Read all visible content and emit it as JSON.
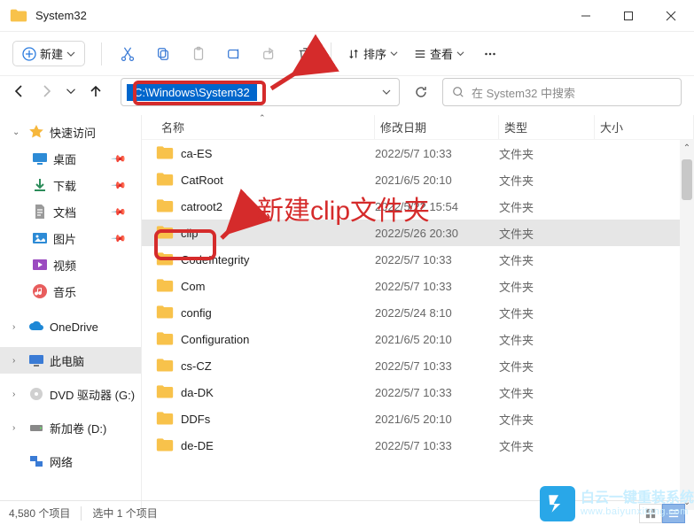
{
  "window": {
    "title": "System32"
  },
  "toolbar": {
    "new_label": "新建",
    "sort_label": "排序",
    "view_label": "查看"
  },
  "address": {
    "path": "C:\\Windows\\System32"
  },
  "search": {
    "placeholder": "在 System32 中搜索"
  },
  "sidebar": {
    "quick": "快速访问",
    "desktop": "桌面",
    "downloads": "下载",
    "documents": "文档",
    "pictures": "图片",
    "videos": "视频",
    "music": "音乐",
    "onedrive": "OneDrive",
    "thispc": "此电脑",
    "dvd": "DVD 驱动器 (G:)",
    "newvol": "新加卷 (D:)",
    "network": "网络"
  },
  "columns": {
    "name": "名称",
    "date": "修改日期",
    "type": "类型",
    "size": "大小"
  },
  "rows": [
    {
      "name": "ca-ES",
      "date": "2022/5/7 10:33",
      "type": "文件夹"
    },
    {
      "name": "CatRoot",
      "date": "2021/6/5 20:10",
      "type": "文件夹"
    },
    {
      "name": "catroot2",
      "date": "2022/5/22 15:54",
      "type": "文件夹"
    },
    {
      "name": "clip",
      "date": "2022/5/26 20:30",
      "type": "文件夹"
    },
    {
      "name": "CodeIntegrity",
      "date": "2022/5/7 10:33",
      "type": "文件夹"
    },
    {
      "name": "Com",
      "date": "2022/5/7 10:33",
      "type": "文件夹"
    },
    {
      "name": "config",
      "date": "2022/5/24 8:10",
      "type": "文件夹"
    },
    {
      "name": "Configuration",
      "date": "2021/6/5 20:10",
      "type": "文件夹"
    },
    {
      "name": "cs-CZ",
      "date": "2022/5/7 10:33",
      "type": "文件夹"
    },
    {
      "name": "da-DK",
      "date": "2022/5/7 10:33",
      "type": "文件夹"
    },
    {
      "name": "DDFs",
      "date": "2021/6/5 20:10",
      "type": "文件夹"
    },
    {
      "name": "de-DE",
      "date": "2022/5/7 10:33",
      "type": "文件夹"
    }
  ],
  "status": {
    "count": "4,580 个项目",
    "selected": "选中 1 个项目"
  },
  "annotation": {
    "text": "新建clip文件夹"
  },
  "watermark": {
    "brand": "白云一键重装系统",
    "url": "www.baiyunxitong.com"
  }
}
